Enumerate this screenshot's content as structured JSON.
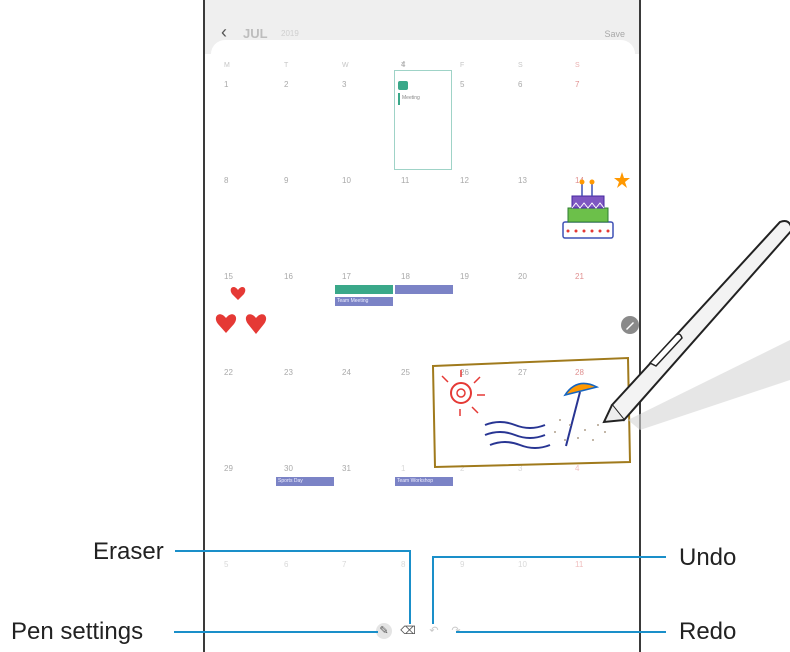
{
  "header": {
    "back_icon": "chevron-left-icon",
    "month": "JUL",
    "year": "2019",
    "save_label": "Save"
  },
  "weekday_labels": [
    "M",
    "T",
    "W",
    "T",
    "F",
    "S",
    "S"
  ],
  "calendar": {
    "weeks": [
      [
        "1",
        "2",
        "3",
        "4",
        "5",
        "6",
        "7"
      ],
      [
        "8",
        "9",
        "10",
        "11",
        "12",
        "13",
        "14"
      ],
      [
        "15",
        "16",
        "17",
        "18",
        "19",
        "20",
        "21"
      ],
      [
        "22",
        "23",
        "24",
        "25",
        "26",
        "27",
        "28"
      ],
      [
        "29",
        "30",
        "31",
        "1",
        "2",
        "3",
        "4"
      ],
      [
        "5",
        "6",
        "7",
        "8",
        "9",
        "10",
        "11"
      ]
    ]
  },
  "event": {
    "title": "Meeting",
    "color": "#3aa889"
  },
  "chips": [
    {
      "text": "",
      "color": "#3aa889"
    },
    {
      "text": "Team Meeting",
      "color": "#7b83c6"
    },
    {
      "text": "",
      "color": "#7b83c6"
    },
    {
      "text": "Sports Day",
      "color": "#7b83c6"
    },
    {
      "text": "Team Workshop",
      "color": "#7b83c6"
    }
  ],
  "toolbar": {
    "pen_settings_icon": "pen-icon",
    "eraser_icon": "eraser-icon",
    "undo_icon": "undo-icon",
    "redo_icon": "redo-icon"
  },
  "callouts": {
    "eraser": "Eraser",
    "pen_settings": "Pen settings",
    "undo": "Undo",
    "redo": "Redo"
  },
  "accent_color": "#1a8fc9"
}
